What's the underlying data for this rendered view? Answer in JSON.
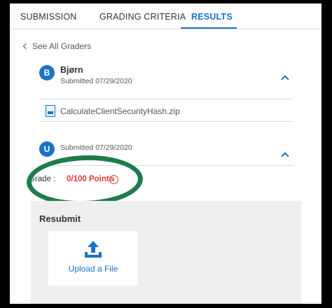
{
  "tabs": [
    {
      "label": "SUBMISSION"
    },
    {
      "label": "GRADING CRITERIA"
    },
    {
      "label": "RESULTS"
    }
  ],
  "back_link": "See All Graders",
  "grader": {
    "initial": "B",
    "name": "Bjørn",
    "submitted": "Submitted 07/29/2020",
    "file": "CalculateClientSecurityHash.zip"
  },
  "second_entry": {
    "initial": "U",
    "submitted": "Submitted 07/29/2020"
  },
  "grade": {
    "label": "Grade :",
    "value": "0/100 Points"
  },
  "resubmit": {
    "title": "Resubmit",
    "upload_label": "Upload a File"
  },
  "colors": {
    "accent": "#1a73c8",
    "error": "#e03a3a",
    "annotation": "#1e7c4a"
  }
}
